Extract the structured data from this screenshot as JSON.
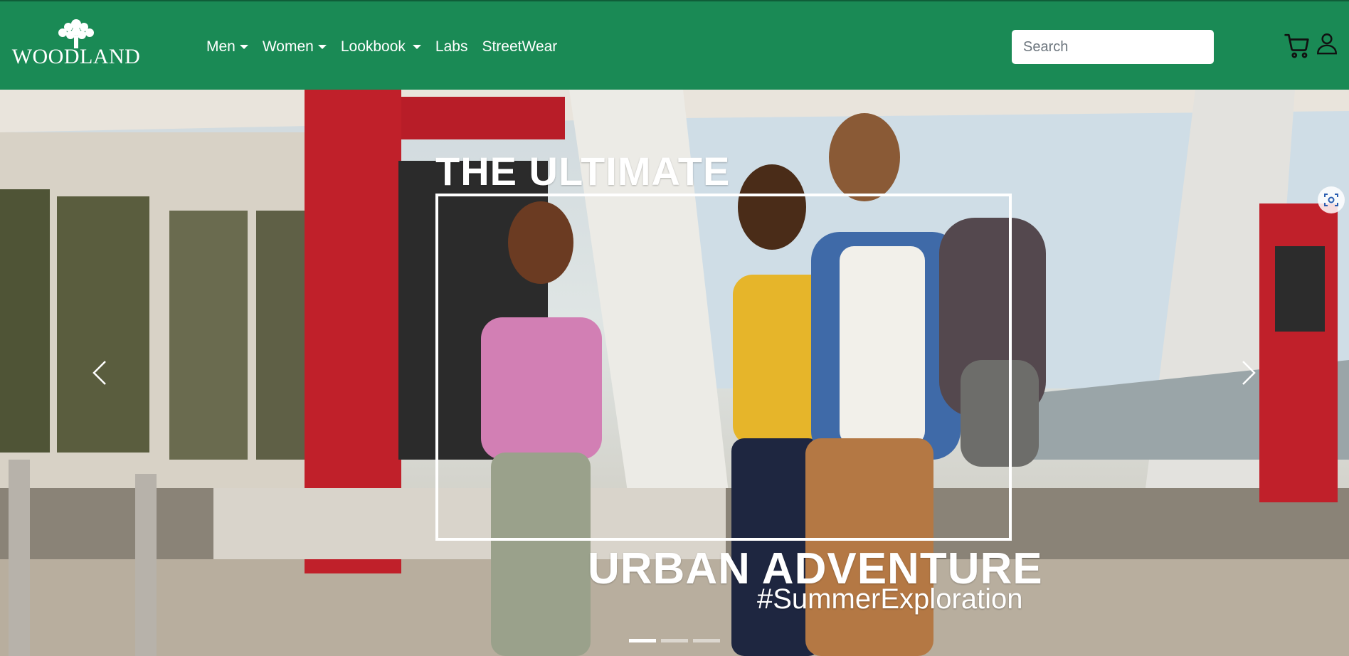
{
  "brand": {
    "name": "WOODLAND"
  },
  "nav": {
    "items": [
      {
        "label": "Men",
        "has_dropdown": true
      },
      {
        "label": "Women",
        "has_dropdown": true
      },
      {
        "label": "Lookbook",
        "has_dropdown": true
      },
      {
        "label": "Labs",
        "has_dropdown": false
      },
      {
        "label": "StreetWear",
        "has_dropdown": false
      }
    ]
  },
  "search": {
    "placeholder": "Search",
    "value": ""
  },
  "header_icons": [
    "cart-icon",
    "user-icon"
  ],
  "hero": {
    "title_top": "THE ULTIMATE",
    "title_bottom": "URBAN ADVENTURE",
    "hashtag": "#SummerExploration",
    "slide_count": 3,
    "active_slide": 1,
    "controls": [
      "chevron-left-icon",
      "chevron-right-icon"
    ]
  },
  "colors": {
    "header_bg": "#1a8a55",
    "text": "#ffffff",
    "pump_red": "#c0202a"
  }
}
